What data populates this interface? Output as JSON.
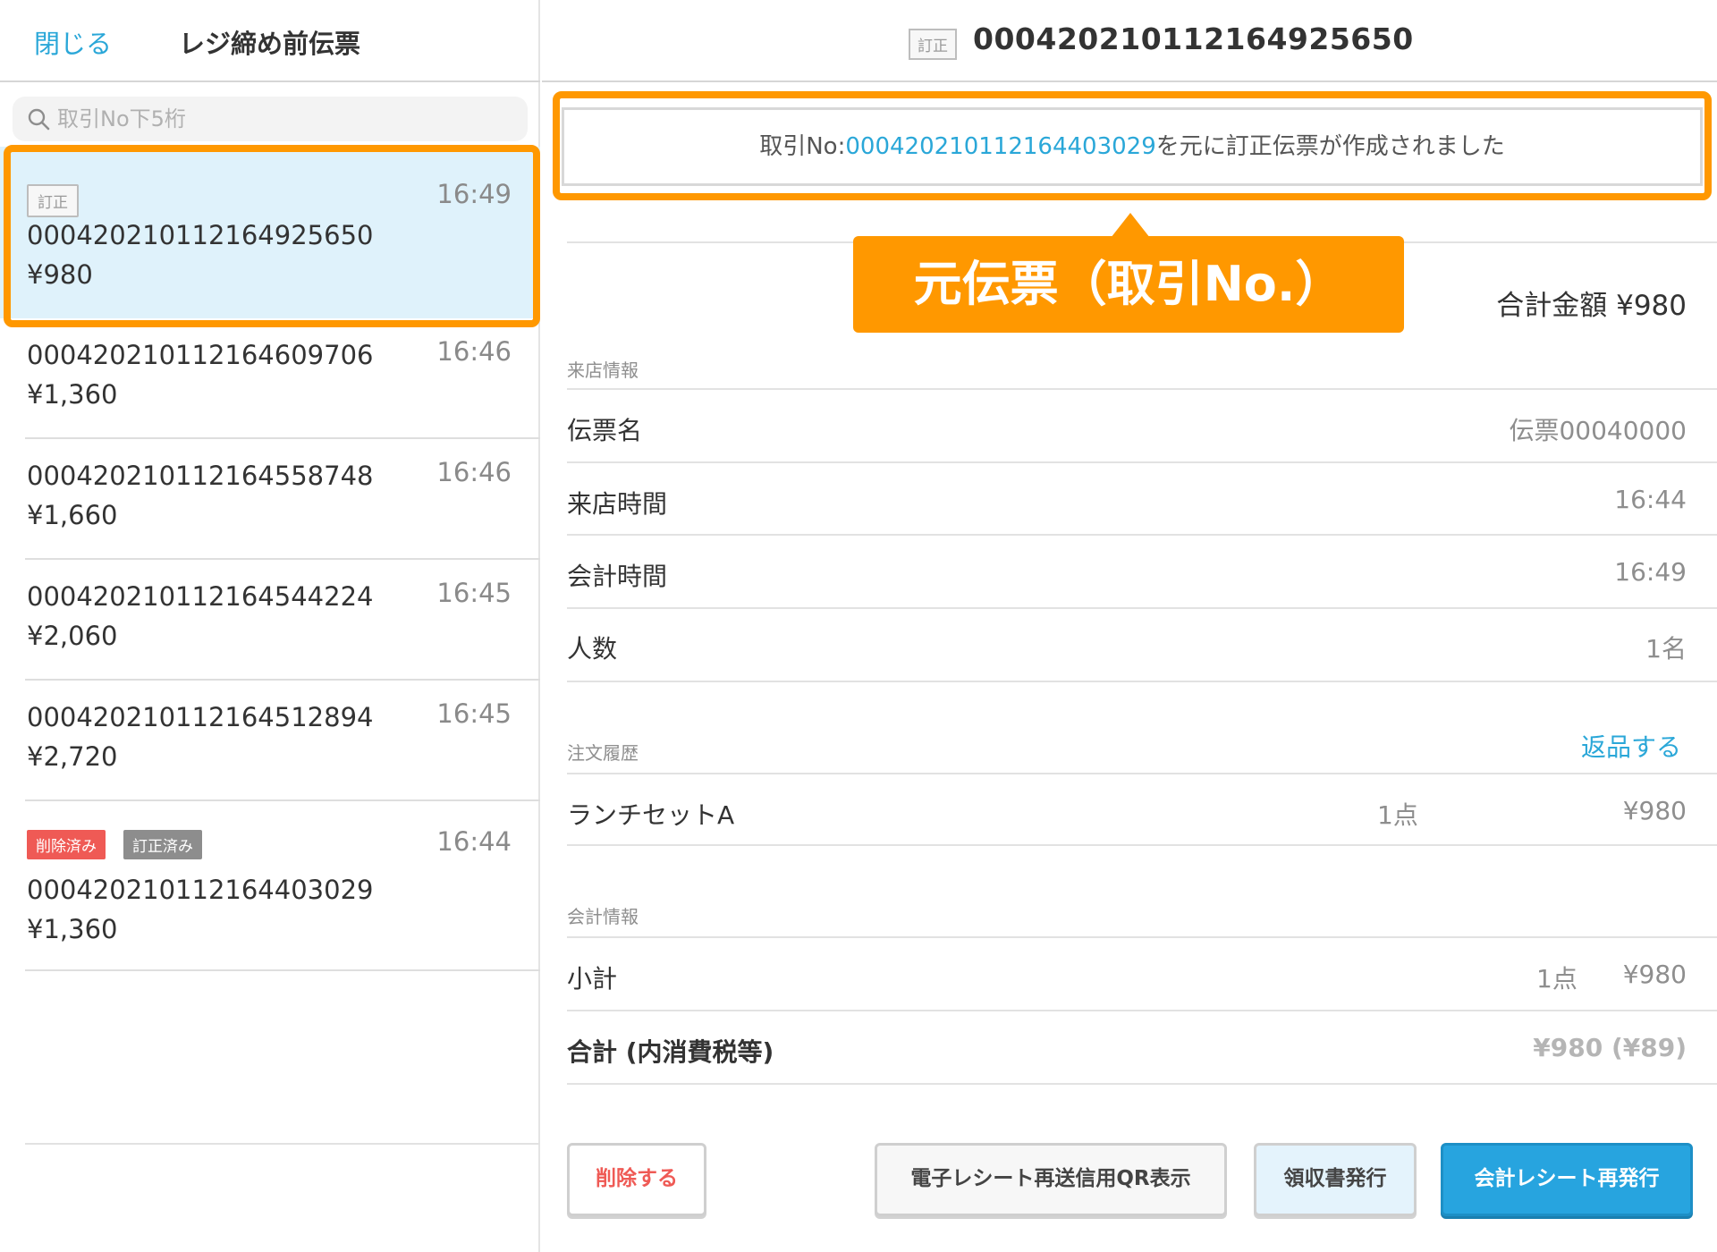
{
  "left": {
    "close_label": "閉じる",
    "title": "レジ締め前伝票",
    "search": {
      "placeholder": "取引No下5桁"
    },
    "transactions": [
      {
        "tags": [
          "訂正"
        ],
        "number": "00042021011216492565O",
        "amount": "¥980",
        "time": "16:49",
        "selected": true
      },
      {
        "tags": [],
        "number": "000420210112164609706",
        "amount": "¥1,360",
        "time": "16:46"
      },
      {
        "tags": [],
        "number": "000420210112164558748",
        "amount": "¥1,660",
        "time": "16:46"
      },
      {
        "tags": [],
        "number": "000420210112164544224",
        "amount": "¥2,060",
        "time": "16:45"
      },
      {
        "tags": [],
        "number": "000420210112164512894",
        "amount": "¥2,720",
        "time": "16:45"
      },
      {
        "tags": [
          "削除済み",
          "訂正済み"
        ],
        "number": "000420210112164403029",
        "amount": "¥1,360",
        "time": "16:44"
      }
    ]
  },
  "right": {
    "header": {
      "tag": "訂正",
      "title": "000420210112164925650"
    },
    "notice": {
      "prefix": "取引No:",
      "link": "000420210112164403029",
      "suffix": "を元に訂正伝票が作成されました"
    },
    "callout": "元伝票（取引No.）",
    "total": "合計金額 ¥980",
    "visit": {
      "section": "来店情報",
      "rows": [
        {
          "label": "伝票名",
          "value": "伝票00040000"
        },
        {
          "label": "来店時間",
          "value": "16:44"
        },
        {
          "label": "会計時間",
          "value": "16:49"
        },
        {
          "label": "人数",
          "value": "1名"
        }
      ]
    },
    "orders": {
      "section": "注文履歴",
      "return_label": "返品する",
      "items": [
        {
          "name": "ランチセットA",
          "qty": "1点",
          "price": "¥980"
        }
      ]
    },
    "payment": {
      "section": "会計情報",
      "subtotal_label": "小計",
      "subtotal_qty": "1点",
      "subtotal_value": "¥980",
      "total_label": "合計 (内消費税等)",
      "total_value": "¥980 (¥89)"
    },
    "buttons": {
      "delete": "削除する",
      "qr": "電子レシート再送信用QR表示",
      "receipt": "領収書発行",
      "reissue": "会計レシート再発行"
    }
  },
  "colors": {
    "accent": "#2aa7d8",
    "highlight": "#ff9800",
    "selected_row": "#dff2fb",
    "danger": "#ef5a55"
  }
}
